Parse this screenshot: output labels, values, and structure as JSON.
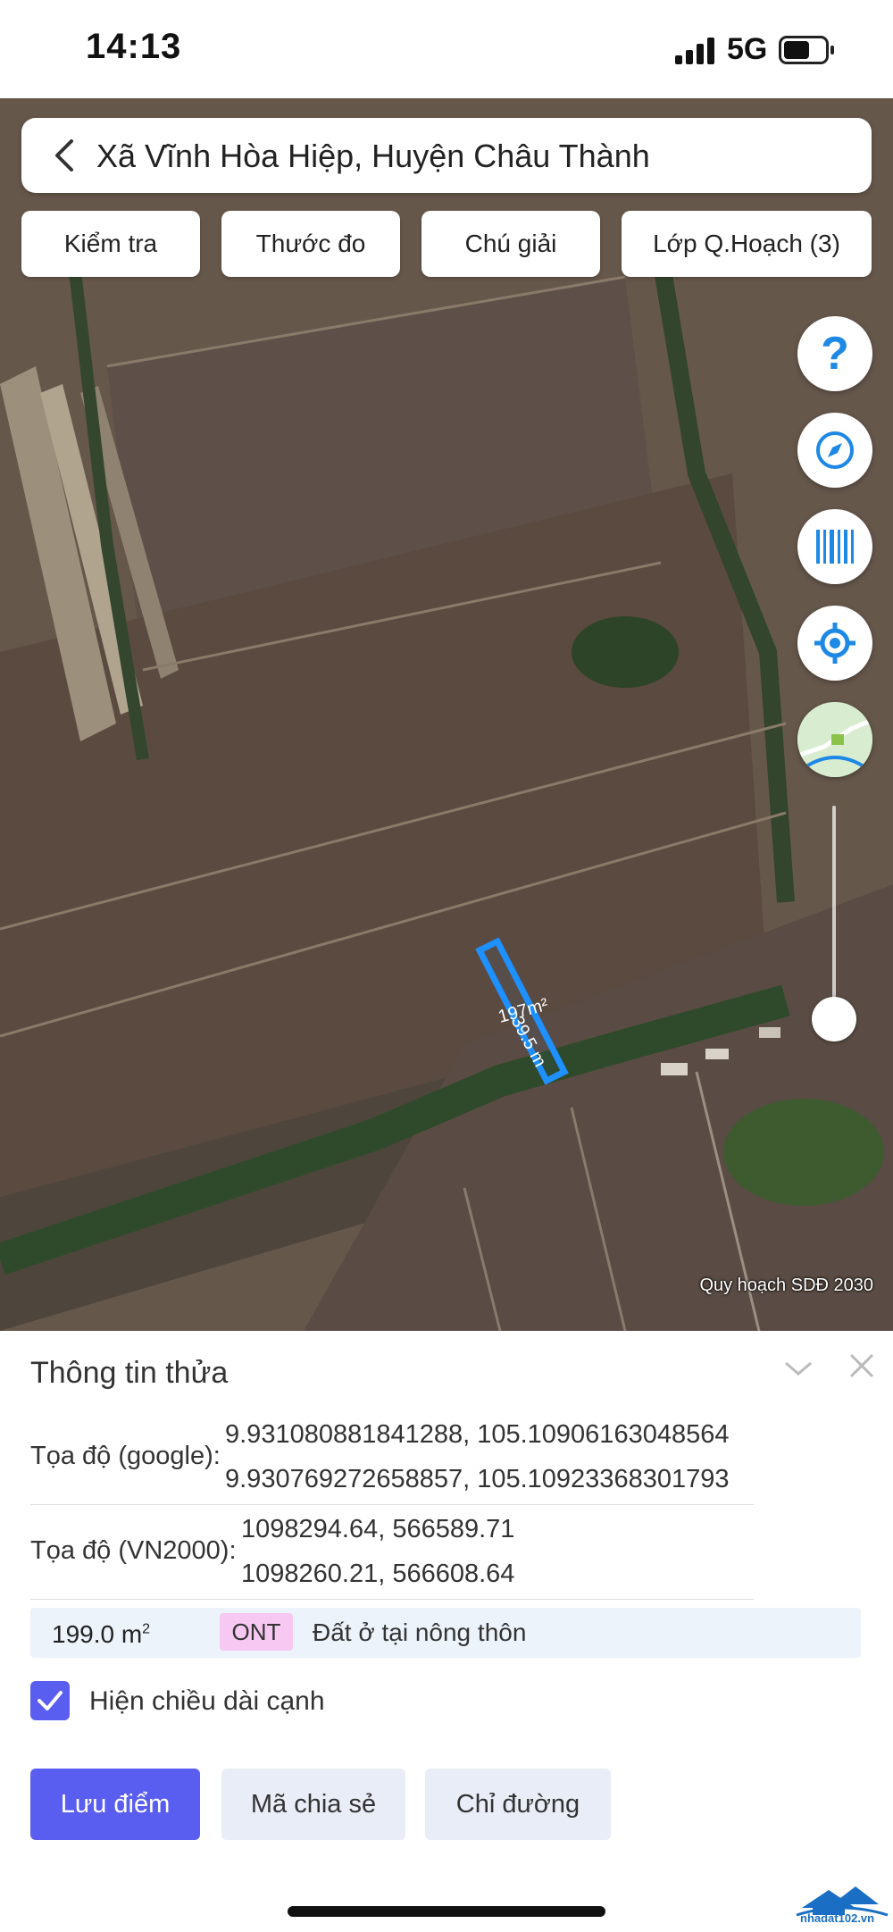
{
  "status_bar": {
    "time": "14:13",
    "network": "5G"
  },
  "search": {
    "title": "Xã Vĩnh Hòa Hiệp, Huyện Châu Thành"
  },
  "toolbar": {
    "check_label": "Kiểm tra",
    "measure_label": "Thước đo",
    "legend_label": "Chú giải",
    "layers_label": "Lớp Q.Hoạch (3)"
  },
  "map": {
    "parcel_area_label": "197m²",
    "parcel_side_label": "39.5 m",
    "layer_caption": "Quy hoạch SDĐ 2030",
    "icons": [
      "help-icon",
      "compass-icon",
      "barcode-icon",
      "locate-icon",
      "minimap-thumbnail"
    ]
  },
  "panel": {
    "title": "Thông tin thửa",
    "google_label": "Tọa độ (google):",
    "google_coords": [
      "9.931080881841288, 105.10906163048564",
      "9.930769272658857, 105.10923368301793"
    ],
    "vn2000_label": "Tọa độ (VN2000):",
    "vn2000_coords": [
      "1098294.64, 566589.71",
      "1098260.21, 566608.64"
    ],
    "area_value": "199.0 m",
    "area_sup": "2",
    "zone_code": "ONT",
    "zone_desc": "Đất ở tại nông thôn",
    "zone_badge_color": "#f7c9f2",
    "show_edges_label": "Hiện chiều dài cạnh",
    "show_edges_checked": true,
    "save_label": "Lưu điểm",
    "share_label": "Mã chia sẻ",
    "directions_label": "Chỉ đường",
    "accent_color": "#5a5ef0"
  },
  "watermark": {
    "text": "nhadat102.vn"
  }
}
